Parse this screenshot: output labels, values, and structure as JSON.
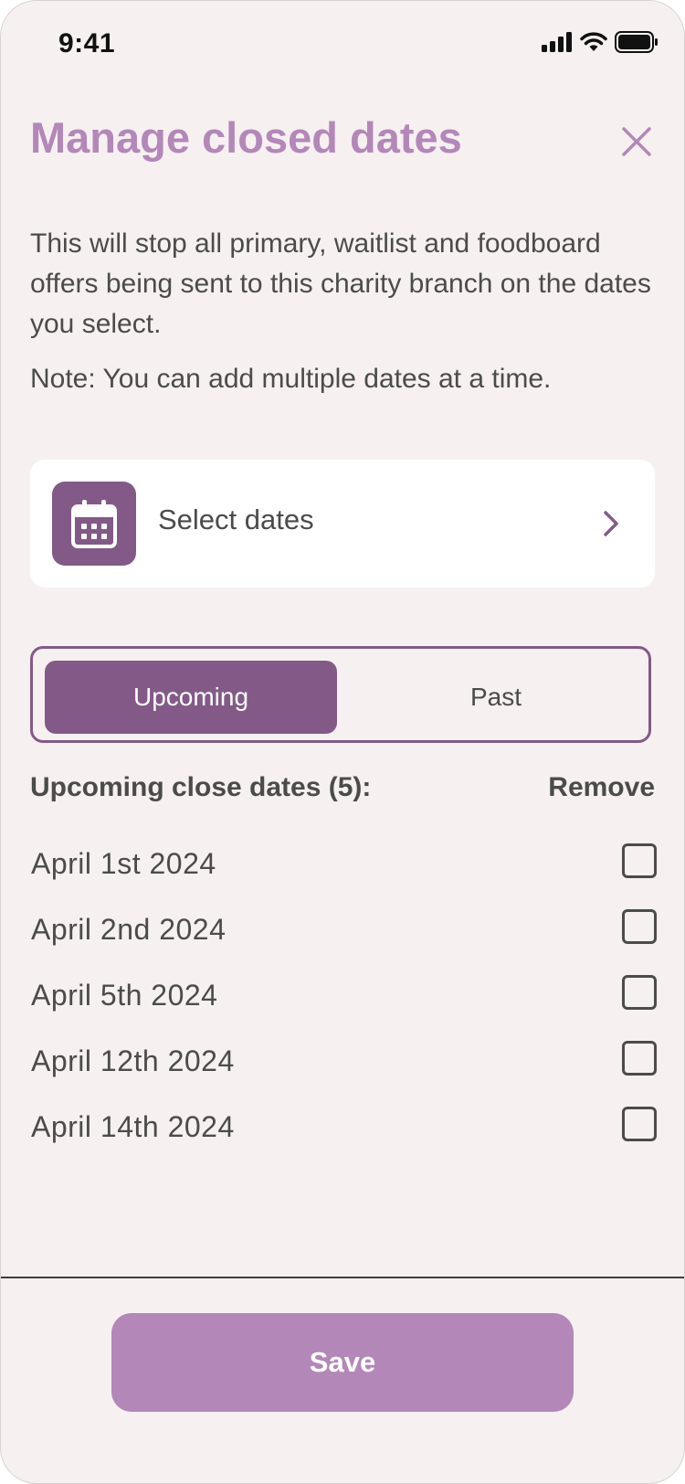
{
  "status_bar": {
    "time": "9:41",
    "icons": [
      "signal-icon",
      "wifi-icon",
      "battery-icon"
    ]
  },
  "header": {
    "title": "Manage closed dates",
    "close_icon": "close-icon"
  },
  "description": "This will stop all primary, waitlist and foodboard offers being sent to this charity branch on the dates you select.",
  "note": "Note: You can add multiple dates at a time.",
  "select_dates": {
    "label": "Select dates",
    "icon": "calendar-icon",
    "chevron": "chevron-right-icon"
  },
  "tabs": {
    "items": [
      {
        "label": "Upcoming",
        "active": true
      },
      {
        "label": "Past",
        "active": false
      }
    ]
  },
  "list": {
    "heading": "Upcoming close dates (5):",
    "remove_label": "Remove",
    "dates": [
      {
        "label": "April 1st 2024",
        "checked": false
      },
      {
        "label": "April 2nd 2024",
        "checked": false
      },
      {
        "label": "April 5th 2024",
        "checked": false
      },
      {
        "label": "April 12th 2024",
        "checked": false
      },
      {
        "label": "April 14th 2024",
        "checked": false
      }
    ]
  },
  "footer": {
    "save_label": "Save"
  },
  "colors": {
    "background": "#f7f0f1",
    "title": "#b387b8",
    "accent": "#835a87",
    "text": "#4b4b4b",
    "save_button": "#b387b8"
  }
}
